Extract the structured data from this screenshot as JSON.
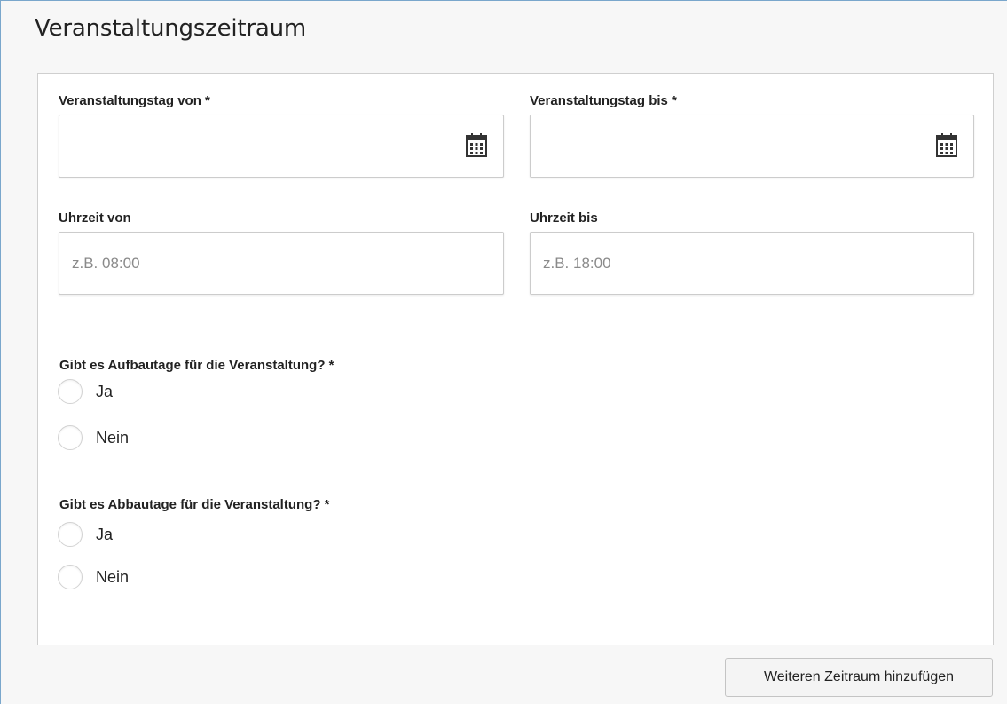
{
  "section": {
    "title": "Veranstaltungszeitraum"
  },
  "fields": {
    "date_from": {
      "label": "Veranstaltungstag von *",
      "value": "",
      "icon": "calendar-icon"
    },
    "date_to": {
      "label": "Veranstaltungstag bis *",
      "value": "",
      "icon": "calendar-icon"
    },
    "time_from": {
      "label": "Uhrzeit von",
      "value": "",
      "placeholder": "z.B. 08:00"
    },
    "time_to": {
      "label": "Uhrzeit bis",
      "value": "",
      "placeholder": "z.B. 18:00"
    }
  },
  "questions": {
    "setup_days": {
      "label": "Gibt es Aufbautage für die Veranstaltung? *",
      "options": [
        "Ja",
        "Nein"
      ]
    },
    "teardown_days": {
      "label": "Gibt es Abbautage für die Veranstaltung? *",
      "options": [
        "Ja",
        "Nein"
      ]
    }
  },
  "actions": {
    "add_period_label": "Weiteren Zeitraum hinzufügen"
  },
  "colors": {
    "frame_border": "#7aa7cc",
    "page_background": "#f7f7f7",
    "panel_background": "#ffffff"
  }
}
